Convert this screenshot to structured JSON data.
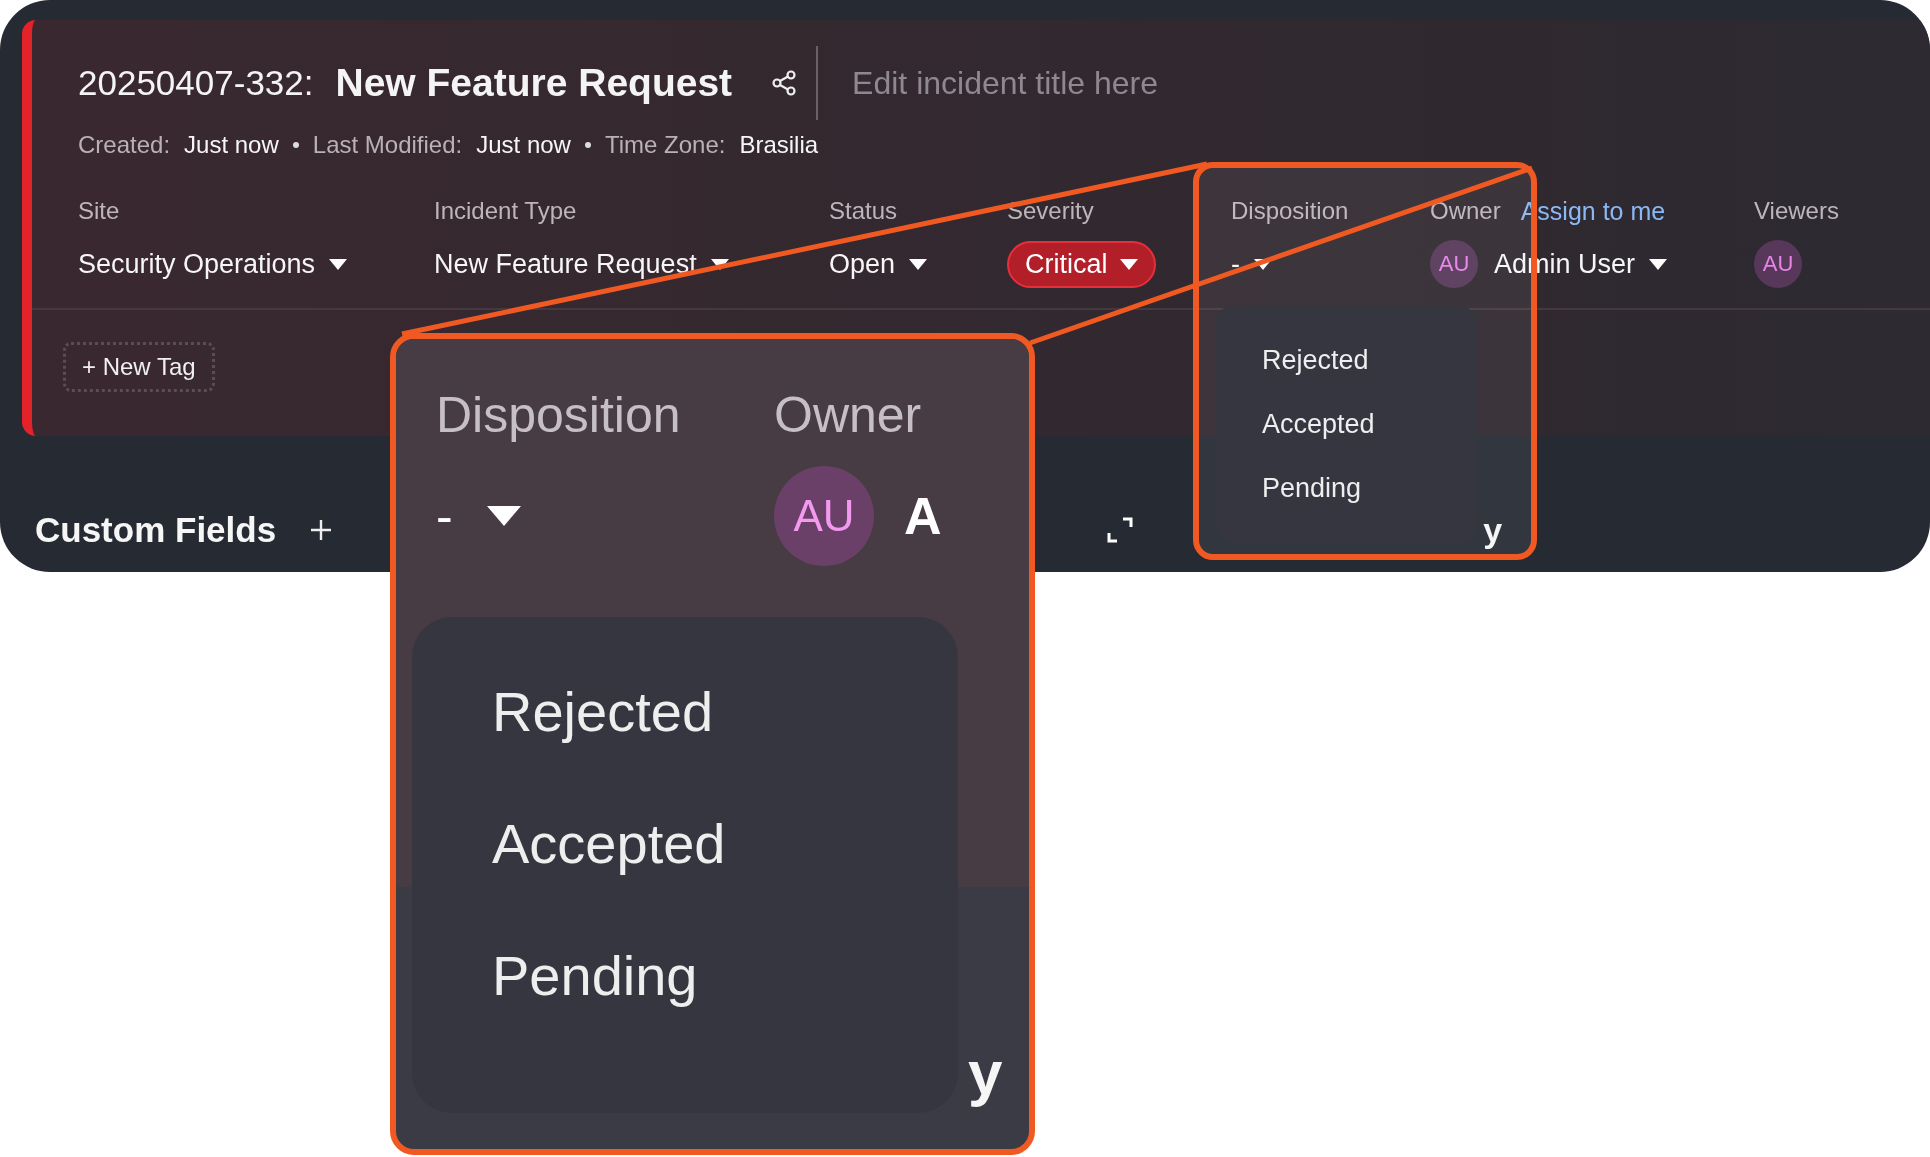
{
  "incident": {
    "id": "20250407-332:",
    "title": "New Feature Request",
    "title_placeholder": "Edit incident title here"
  },
  "meta": [
    {
      "label": "Created:",
      "value": "Just now"
    },
    {
      "label": "Last Modified:",
      "value": "Just now"
    },
    {
      "label": "Time Zone:",
      "value": "Brasilia"
    }
  ],
  "fields": [
    {
      "kind": "dropdown",
      "label": "Site",
      "value": "Security Operations"
    },
    {
      "kind": "dropdown",
      "label": "Incident Type",
      "value": "New Feature Request"
    },
    {
      "kind": "dropdown",
      "label": "Status",
      "value": "Open"
    },
    {
      "kind": "pill",
      "label": "Severity",
      "value": "Critical"
    },
    {
      "kind": "dropdown",
      "label": "Disposition",
      "value": "-",
      "expanded": true,
      "options": [
        "Rejected",
        "Accepted",
        "Pending"
      ]
    },
    {
      "kind": "user",
      "label": "Owner",
      "link": "Assign to me",
      "avatar": "AU",
      "value": "Admin User"
    },
    {
      "kind": "avatars",
      "label": "Viewers",
      "avatars": [
        "AU"
      ]
    }
  ],
  "tag_button": "+ New Tag",
  "custom_fields": {
    "title": "Custom Fields",
    "hidden_text_fragment": "y"
  },
  "callout": {
    "labels": [
      "Disposition",
      "Owner"
    ],
    "value": "-",
    "avatar": "AU",
    "owner_fragment": "A",
    "options": [
      "Rejected",
      "Accepted",
      "Pending"
    ],
    "hidden_text_fragment": "y"
  }
}
